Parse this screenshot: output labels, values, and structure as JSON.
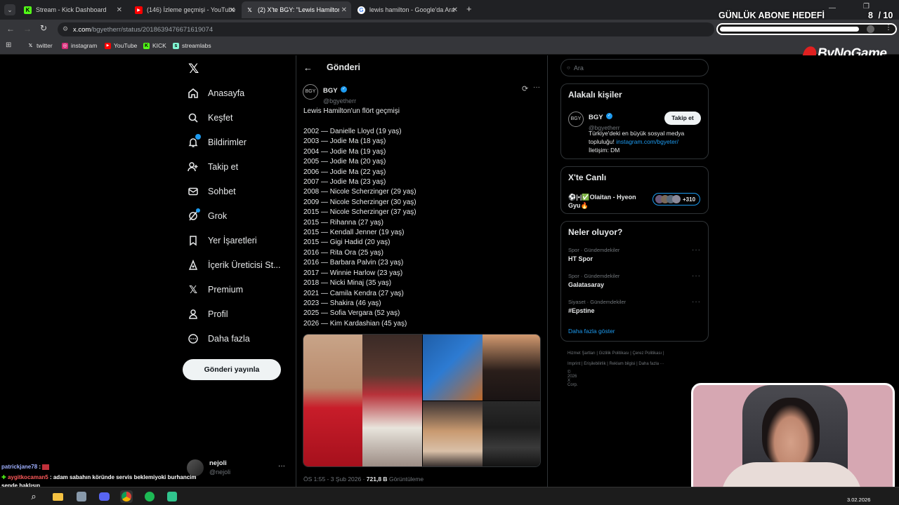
{
  "browser": {
    "tabs": [
      {
        "label": "Stream - Kick Dashboard",
        "icon": "kick-icon"
      },
      {
        "label": "(146) İzleme geçmişi - YouTube",
        "icon": "youtube-icon"
      },
      {
        "label": "(2) X'te BGY: \"Lewis Hamilton'u",
        "icon": "x-icon"
      },
      {
        "label": "lewis hamilton - Google'da Ara",
        "icon": "google-icon"
      }
    ],
    "url_domain": "x.com",
    "url_path": "/bgyetherr/status/2018639476671619074",
    "bookmarks": [
      {
        "label": "twitter",
        "icon": "x-icon"
      },
      {
        "label": "instagram",
        "icon": "instagram-icon"
      },
      {
        "label": "YouTube",
        "icon": "youtube-icon"
      },
      {
        "label": "KICK",
        "icon": "kick-icon"
      },
      {
        "label": "streamlabs",
        "icon": "streamlabs-icon"
      }
    ]
  },
  "overlay": {
    "goal_title": "GÜNLÜK ABONE HEDEFİ",
    "goal_current": "8",
    "goal_target": "/ 10",
    "goal_progress": 0.8,
    "brand": "ByNoGame"
  },
  "sidebar": {
    "items": [
      {
        "label": "Anasayfa",
        "icon": "home-icon"
      },
      {
        "label": "Keşfet",
        "icon": "search-icon"
      },
      {
        "label": "Bildirimler",
        "icon": "bell-icon"
      },
      {
        "label": "Takip et",
        "icon": "follow-icon"
      },
      {
        "label": "Sohbet",
        "icon": "mail-icon"
      },
      {
        "label": "Grok",
        "icon": "grok-icon"
      },
      {
        "label": "Yer İşaretleri",
        "icon": "bookmark-icon"
      },
      {
        "label": "İçerik Üreticisi St...",
        "icon": "creator-icon"
      },
      {
        "label": "Premium",
        "icon": "x-icon"
      },
      {
        "label": "Profil",
        "icon": "profile-icon"
      },
      {
        "label": "Daha fazla",
        "icon": "more-icon"
      }
    ],
    "post_button": "Gönderi yayınla",
    "account_name": "nejoli",
    "account_handle": "@nejoli"
  },
  "post": {
    "header": "Gönderi",
    "author_name": "BGY",
    "author_handle": "@bgyetherr",
    "intro": "Lewis Hamilton'un flört geçmişi",
    "lines": [
      "2002 — Danielle Lloyd (19 yaş)",
      "2003 — Jodie Ma (18 yaş)",
      "2004 — Jodie Ma (19 yaş)",
      "2005 — Jodie Ma (20 yaş)",
      "2006 — Jodie Ma (22 yaş)",
      "2007 — Jodie Ma (23 yaş)",
      "2008 — Nicole Scherzinger (29 yaş)",
      "2009 — Nicole Scherzinger (30 yaş)",
      "2015 — Nicole Scherzinger (37 yaş)",
      "2015 — Rihanna (27 yaş)",
      "2015 — Kendall Jenner (19 yaş)",
      "2015 — Gigi Hadid (20 yaş)",
      "2016 — Rita Ora (25 yaş)",
      "2016 — Barbara Palvin (23 yaş)",
      "2017 — Winnie Harlow (23 yaş)",
      "2018 — Nicki Minaj (35 yaş)",
      "2021 — Camila Kendra (27 yaş)",
      "2023 — Shakira (46 yaş)",
      "2025 — Sofia Vergara (52 yaş)",
      "2026 — Kim Kardashian (45 yaş)"
    ],
    "meta_time": "ÖS 1:55 - 3 Şub 2026 ·",
    "meta_views": "721,8 B",
    "meta_views_label": "Görüntüleme"
  },
  "right": {
    "search_placeholder": "Ara",
    "related_title": "Alakalı kişiler",
    "related_name": "BGY",
    "related_handle": "@bgyetherr",
    "follow_button": "Takip et",
    "related_bio_1": "Türkiye'deki en büyük sosyal medya",
    "related_bio_2a": "topluluğu! ",
    "related_bio_2b": "instagram.com/bgyeter/",
    "related_bio_3": "İletişim: DM",
    "live_title": "X'te Canlı",
    "live_text_1": "⚽|•|✅Olaitan - Hyeon",
    "live_text_2": "Gyu🔥",
    "live_count": "+310",
    "trends_title": "Neler oluyor?",
    "trends": [
      {
        "category": "Spor · Gündemdekiler",
        "topic": "HT Spor"
      },
      {
        "category": "Spor · Gündemdekiler",
        "topic": "Galatasaray"
      },
      {
        "category": "Siyaset · Gündemdekiler",
        "topic": "#Epstine"
      }
    ],
    "show_more": "Daha fazla göster",
    "footer_1": "Hizmet Şartları  |  Gizlilik Politikası  |  Çerez Politikası  |",
    "footer_2": "Imprint  |  Erişilebilirlik  |  Reklam bilgisi  |  Daha fazla ···",
    "footer_3": "© 2026 X Corp."
  },
  "chat": [
    {
      "user": "patrickjane78",
      "sep": " : ",
      "msg": "",
      "color": "#9fb0ff"
    },
    {
      "user": "aygitkocaman5",
      "sep": " : ",
      "msg": "adam sabahın köründe servis beklemiyoki burhancim",
      "color": "#ff5a5a"
    },
    {
      "user": "",
      "sep": "",
      "msg": "sende haklısın",
      "color": "#ffffff"
    }
  ],
  "taskbar": {
    "date": "3.02.2026"
  }
}
